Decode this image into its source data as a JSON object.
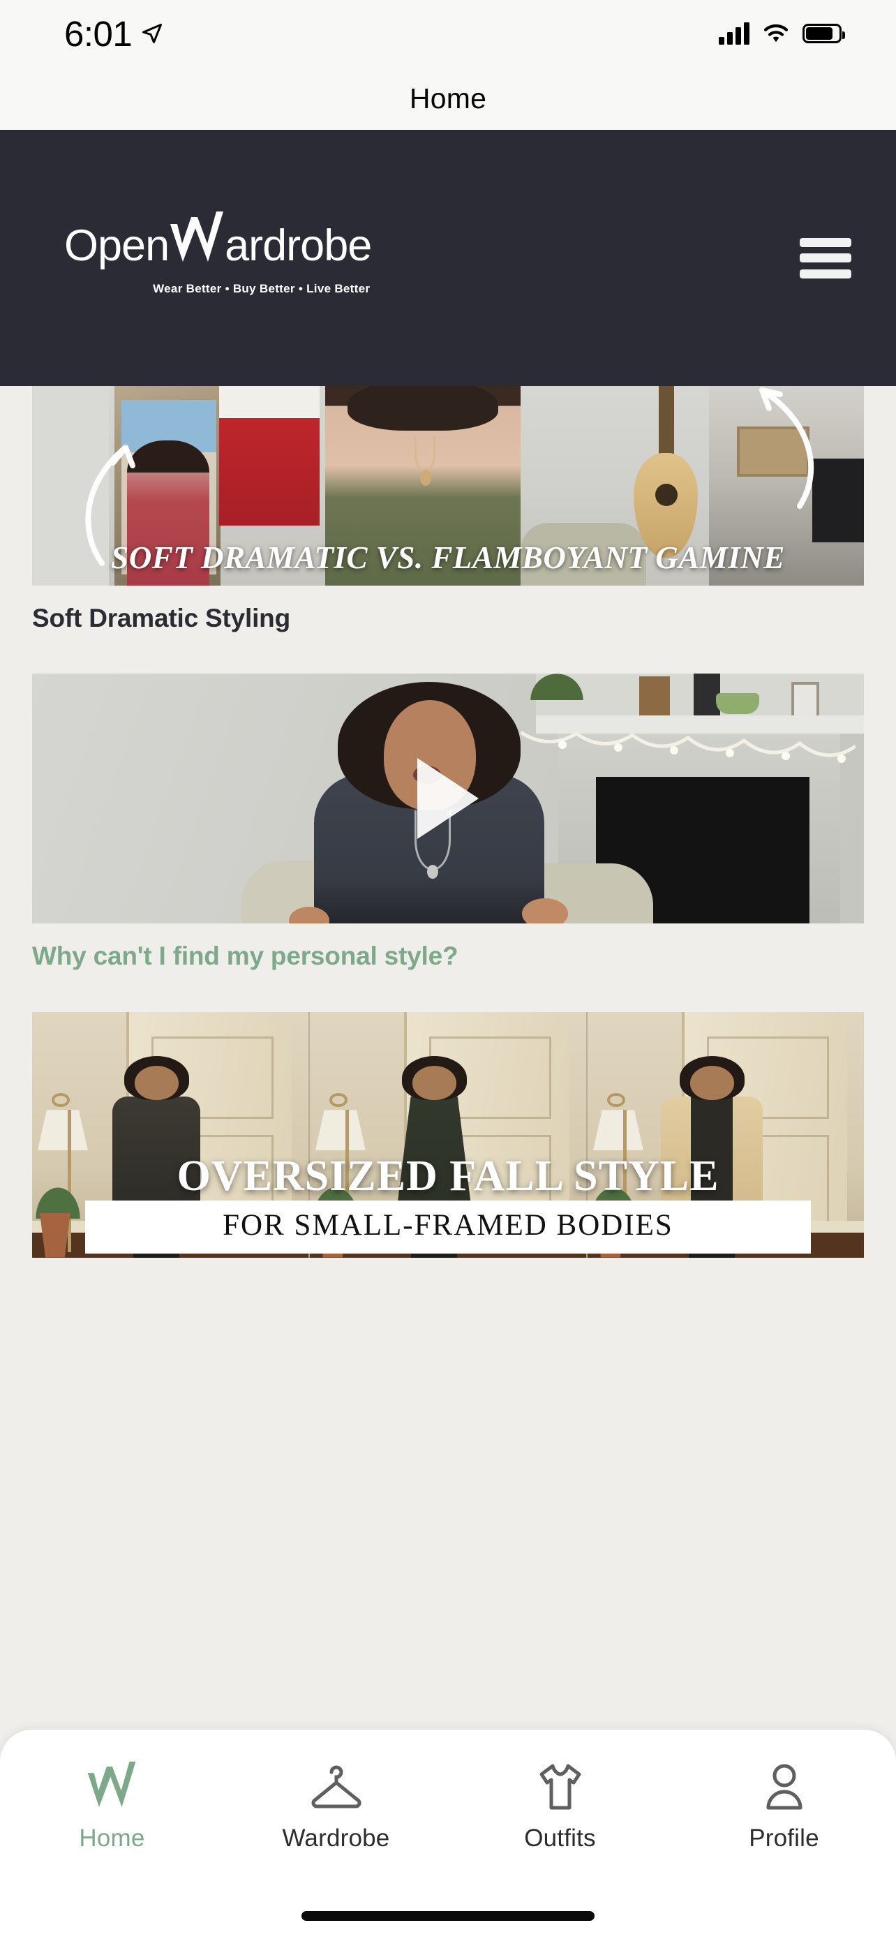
{
  "status_bar": {
    "time": "6:01",
    "location_icon": "location-arrow-icon",
    "cellular_icon": "cellular-signal-icon",
    "wifi_icon": "wifi-icon",
    "battery_icon": "battery-icon"
  },
  "nav": {
    "title": "Home"
  },
  "brand_header": {
    "logo_part1": "Open",
    "logo_part2": "ardrobe",
    "logo_full": "OpenWardrobe",
    "tagline": "Wear Better • Buy Better • Live Better",
    "menu_icon": "hamburger-menu-icon",
    "background_color": "#2B2B36"
  },
  "feed": {
    "cards": [
      {
        "overlay_text": "SOFT DRAMATIC VS. FLAMBOYANT GAMINE",
        "title": "Soft Dramatic Styling",
        "title_color": "#2B2B33"
      },
      {
        "overlay_text": "",
        "title": "Why can't I find my personal style?",
        "title_color": "#7DA98A",
        "play_icon": "play-triangle-icon"
      },
      {
        "overlay_title": "OVERSIZED FALL STYLE",
        "overlay_subtitle": "FOR SMALL-FRAMED BODIES",
        "title": "",
        "title_color": "#2B2B33"
      }
    ]
  },
  "tab_bar": {
    "items": [
      {
        "label": "Home",
        "icon": "w-logo-mark-icon",
        "active": true
      },
      {
        "label": "Wardrobe",
        "icon": "clothes-hanger-icon",
        "active": false
      },
      {
        "label": "Outfits",
        "icon": "tshirt-icon",
        "active": false
      },
      {
        "label": "Profile",
        "icon": "person-icon",
        "active": false
      }
    ],
    "active_color": "#7DA98A",
    "inactive_color": "#2C2C2C"
  },
  "home_indicator": "home-indicator-bar",
  "theme": {
    "page_background": "#EFEEEA",
    "header_background": "#2B2B36",
    "accent_green": "#7DA98A"
  }
}
